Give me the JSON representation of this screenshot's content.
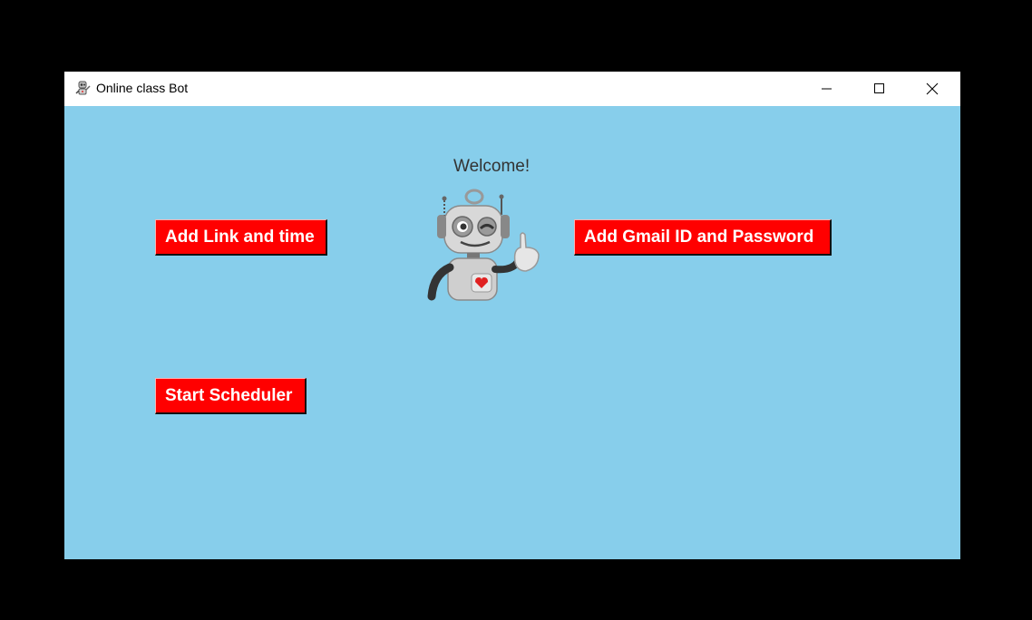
{
  "window": {
    "title": "Online class Bot",
    "icon": "robot-icon",
    "controls": {
      "minimize_icon": "minimize-icon",
      "maximize_icon": "maximize-icon",
      "close_icon": "close-icon"
    }
  },
  "main": {
    "welcome_text": "Welcome!",
    "mascot": "robot-mascot-image",
    "buttons": {
      "add_link": "Add Link and time",
      "add_gmail": "Add Gmail ID and Password",
      "start_scheduler": "Start Scheduler"
    }
  },
  "colors": {
    "background": "#87ceeb",
    "button": "#ff0000",
    "button_text": "#ffffff"
  }
}
